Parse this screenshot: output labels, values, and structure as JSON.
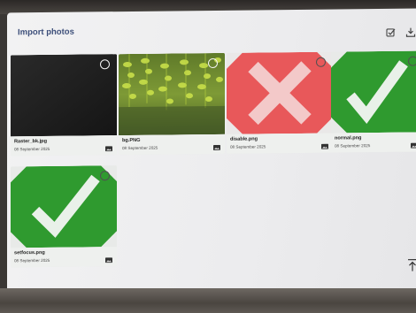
{
  "header": {
    "title": "Import photos",
    "select_icon": "select-all-icon",
    "import_icon": "import-icon"
  },
  "photos": [
    {
      "name": "Raster_bk.jpg",
      "date": "08 September 2025",
      "thumb": "black"
    },
    {
      "name": "bg.PNG",
      "date": "08 September 2025",
      "thumb": "foliage"
    },
    {
      "name": "disable.png",
      "date": "08 September 2025",
      "thumb": "red-x"
    },
    {
      "name": "normal.png",
      "date": "08 September 2025",
      "thumb": "green-check"
    },
    {
      "name": "setfocus.png",
      "date": "08 September 2025",
      "thumb": "green-check"
    }
  ],
  "footer": {
    "scroll_icon": "scroll-to-top-icon"
  },
  "colors": {
    "title": "#3d4f7a",
    "check_green": "#2f9a2f",
    "x_red": "#e8585a",
    "foliage": "#a8c832"
  }
}
